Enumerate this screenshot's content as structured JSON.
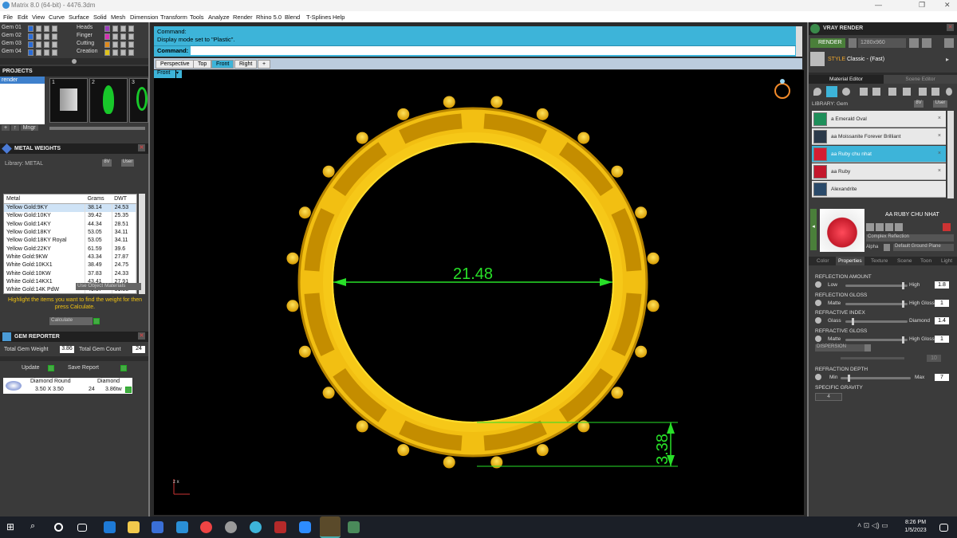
{
  "window": {
    "title": "Matrix 8.0 (64-bit) - 4476.3dm"
  },
  "menu": [
    "File",
    "Edit",
    "View",
    "Curve",
    "Surface",
    "Solid",
    "Mesh",
    "Dimension",
    "Transform",
    "Tools",
    "Analyze",
    "Render",
    "Rhino 5.0",
    "Blend",
    "T-Splines",
    "Help"
  ],
  "layers_left": [
    "Gem 01",
    "Gem 02",
    "Gem 03",
    "Gem 04"
  ],
  "layers_right": [
    "Heads",
    "Finger",
    "Cutting",
    "Creation"
  ],
  "projects": {
    "title": "PROJECTS",
    "item": "render",
    "thumbs": [
      "1",
      "2",
      "3"
    ],
    "mngr": "Mngr"
  },
  "metal_weights": {
    "title": "METAL WEIGHTS",
    "library": "Library: METAL",
    "columns": [
      "Metal",
      "Grams",
      "DWT"
    ],
    "rows": [
      [
        "Yellow Gold:9KY",
        "38.14",
        "24.53"
      ],
      [
        "Yellow Gold:10KY",
        "39.42",
        "25.35"
      ],
      [
        "Yellow Gold:14KY",
        "44.34",
        "28.51"
      ],
      [
        "Yellow Gold:18KY",
        "53.05",
        "34.11"
      ],
      [
        "Yellow Gold:18KY Royal",
        "53.05",
        "34.11"
      ],
      [
        "Yellow Gold:22KY",
        "61.59",
        "39.6"
      ],
      [
        "White Gold:9KW",
        "43.34",
        "27.87"
      ],
      [
        "White Gold:10KX1",
        "38.49",
        "24.75"
      ],
      [
        "White Gold:10KW",
        "37.83",
        "24.33"
      ],
      [
        "White Gold:14KX1",
        "43.41",
        "27.91"
      ],
      [
        "White Gold:14K PdW",
        "49.57",
        "31.88"
      ]
    ],
    "use_object_materials": "Use Object Materials",
    "hint": "Highlight the items you want to find the weight for then press Calculate.",
    "calculate": "Calculate"
  },
  "gem_reporter": {
    "title": "GEM REPORTER",
    "total_weight_label": "Total Gem Weight",
    "total_weight": "3.86",
    "total_count_label": "Total Gem Count",
    "total_count": "24",
    "update": "Update",
    "save": "Save Report",
    "row": {
      "shape": "Diamond Round",
      "size": "3.50 X 3.50",
      "material": "Diamond",
      "count": "24",
      "weight": "3.86tw"
    }
  },
  "command": {
    "line1": "Command:",
    "line2": "Display mode set to \"Plastic\".",
    "prompt": "Command:"
  },
  "viewtabs": [
    "Perspective",
    "Top",
    "Front",
    "Right",
    "+"
  ],
  "viewport": {
    "label": "Front",
    "dim_width": "21.48",
    "dim_height": "3.38",
    "axis": "z x"
  },
  "vray": {
    "title": "VRAY RENDER",
    "render": "RENDER",
    "resolution": "1280x960",
    "style_label": "STYLE",
    "style": "Classic - (Fast)",
    "tabs": [
      "Material Editor",
      "Scene Editor"
    ],
    "library": "LIBRARY: Gem",
    "lib_btns": [
      "8V",
      "User"
    ],
    "materials": [
      "a Emerald Oval",
      "aa Moissanite Forever Brilliant",
      "aa Ruby chu nhat",
      "aa Ruby",
      "Alexandrite"
    ],
    "selected_name": "AA RUBY CHU NHAT",
    "selected_type": "Complex Reflection",
    "alpha": "Alpha",
    "ground": "Default Ground Plane",
    "prop_tabs": [
      "Color",
      "Properties",
      "Texture",
      "Scene",
      "Toon",
      "Light"
    ],
    "props": [
      {
        "name": "REFLECTION AMOUNT",
        "lo": "Low",
        "hi": "High",
        "val": "1.8",
        "pos": 0.95
      },
      {
        "name": "REFLECTION GLOSS",
        "lo": "Matte",
        "hi": "High Gloss",
        "val": "1",
        "pos": 0.95
      },
      {
        "name": "REFRACTIVE INDEX",
        "lo": "Glass",
        "hi": "Diamond",
        "val": "1.4",
        "pos": 0.1
      },
      {
        "name": "REFRACTIVE GLOSS",
        "lo": "Matte",
        "hi": "High Gloss",
        "val": "1",
        "pos": 0.95
      }
    ],
    "dispersion": "DISPERSION",
    "dispersion_val": "10",
    "refraction_depth": {
      "name": "REFRACTION DEPTH",
      "lo": "Min",
      "hi": "Max",
      "val": "7",
      "pos": 0.1
    },
    "specific_gravity": "SPECIFIC GRAVITY",
    "sg_val": "4"
  },
  "taskbar": {
    "time": "8:26 PM",
    "date": "1/5/2023"
  },
  "colors": {
    "accent": "#3db4d9",
    "gold": "#f2c312",
    "dim": "#28e028"
  }
}
